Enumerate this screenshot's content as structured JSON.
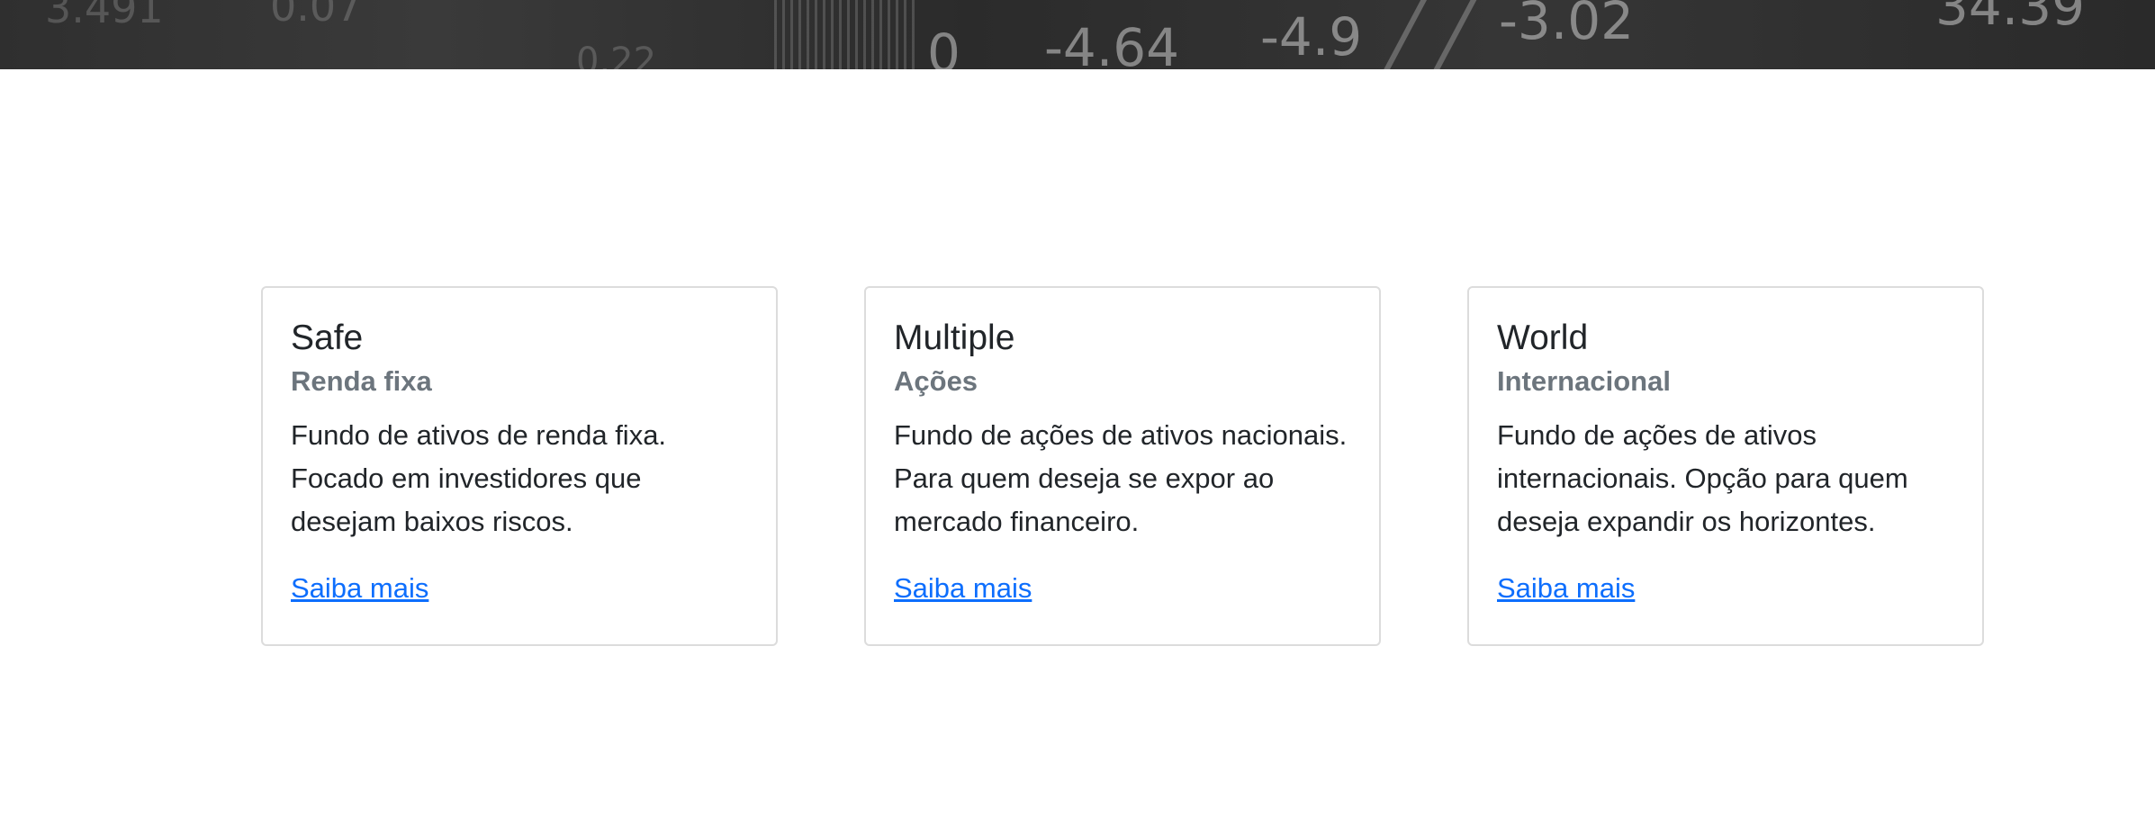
{
  "hero": {
    "ticker_values": [
      "3.491",
      "0.07",
      "0",
      "-4.64",
      "-4.9",
      "-3.02",
      "34.39",
      "0.22"
    ]
  },
  "cards": [
    {
      "title": "Safe",
      "subtitle": "Renda fixa",
      "text": "Fundo de ativos de renda fixa. Focado em investidores que desejam baixos riscos.",
      "link": "Saiba mais"
    },
    {
      "title": "Multiple",
      "subtitle": "Ações",
      "text": "Fundo de ações de ativos nacionais. Para quem deseja se expor ao mercado financeiro.",
      "link": "Saiba mais"
    },
    {
      "title": "World",
      "subtitle": "Internacional",
      "text": "Fundo de ações de ativos internacionais. Opção para quem deseja expandir os horizontes.",
      "link": "Saiba mais"
    }
  ],
  "colors": {
    "link": "#0d6efd",
    "subtitle": "#6c757d",
    "text": "#212529",
    "hero_bg": "#2f2f2f"
  }
}
